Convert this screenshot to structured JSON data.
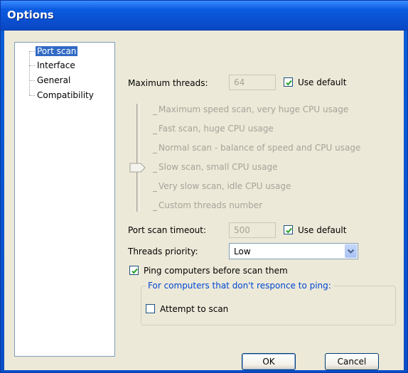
{
  "window": {
    "title": "Options"
  },
  "tree": {
    "items": [
      {
        "label": "Port scan",
        "selected": true
      },
      {
        "label": "Interface",
        "selected": false
      },
      {
        "label": "General",
        "selected": false
      },
      {
        "label": "Compatibility",
        "selected": false
      }
    ]
  },
  "port_scan": {
    "max_threads_label": "Maximum threads:",
    "max_threads_value": "64",
    "use_default_label": "Use default",
    "use_default_checked": true,
    "speed_levels": [
      "Maximum speed scan, very huge CPU usage",
      "Fast scan, huge CPU usage",
      "Normal scan - balance of speed and CPU usage",
      "Slow scan, small CPU usage",
      "Very slow scan, idle CPU usage",
      "Custom threads number"
    ],
    "speed_selected_index": 3,
    "timeout_label": "Port scan timeout:",
    "timeout_value": "500",
    "timeout_use_default_label": "Use default",
    "timeout_use_default_checked": true,
    "priority_label": "Threads priority:",
    "priority_value": "Low",
    "ping_label": "Ping computers before scan them",
    "ping_checked": true,
    "no_ping_group_label": "For computers that don't responce to ping:",
    "attempt_label": "Attempt to scan",
    "attempt_checked": false
  },
  "buttons": {
    "ok": "OK",
    "cancel": "Cancel"
  },
  "colors": {
    "titlebar": "#0a4fd0",
    "dialog_bg": "#ece9d8",
    "selection": "#316ac5",
    "group_label": "#0046d5"
  }
}
